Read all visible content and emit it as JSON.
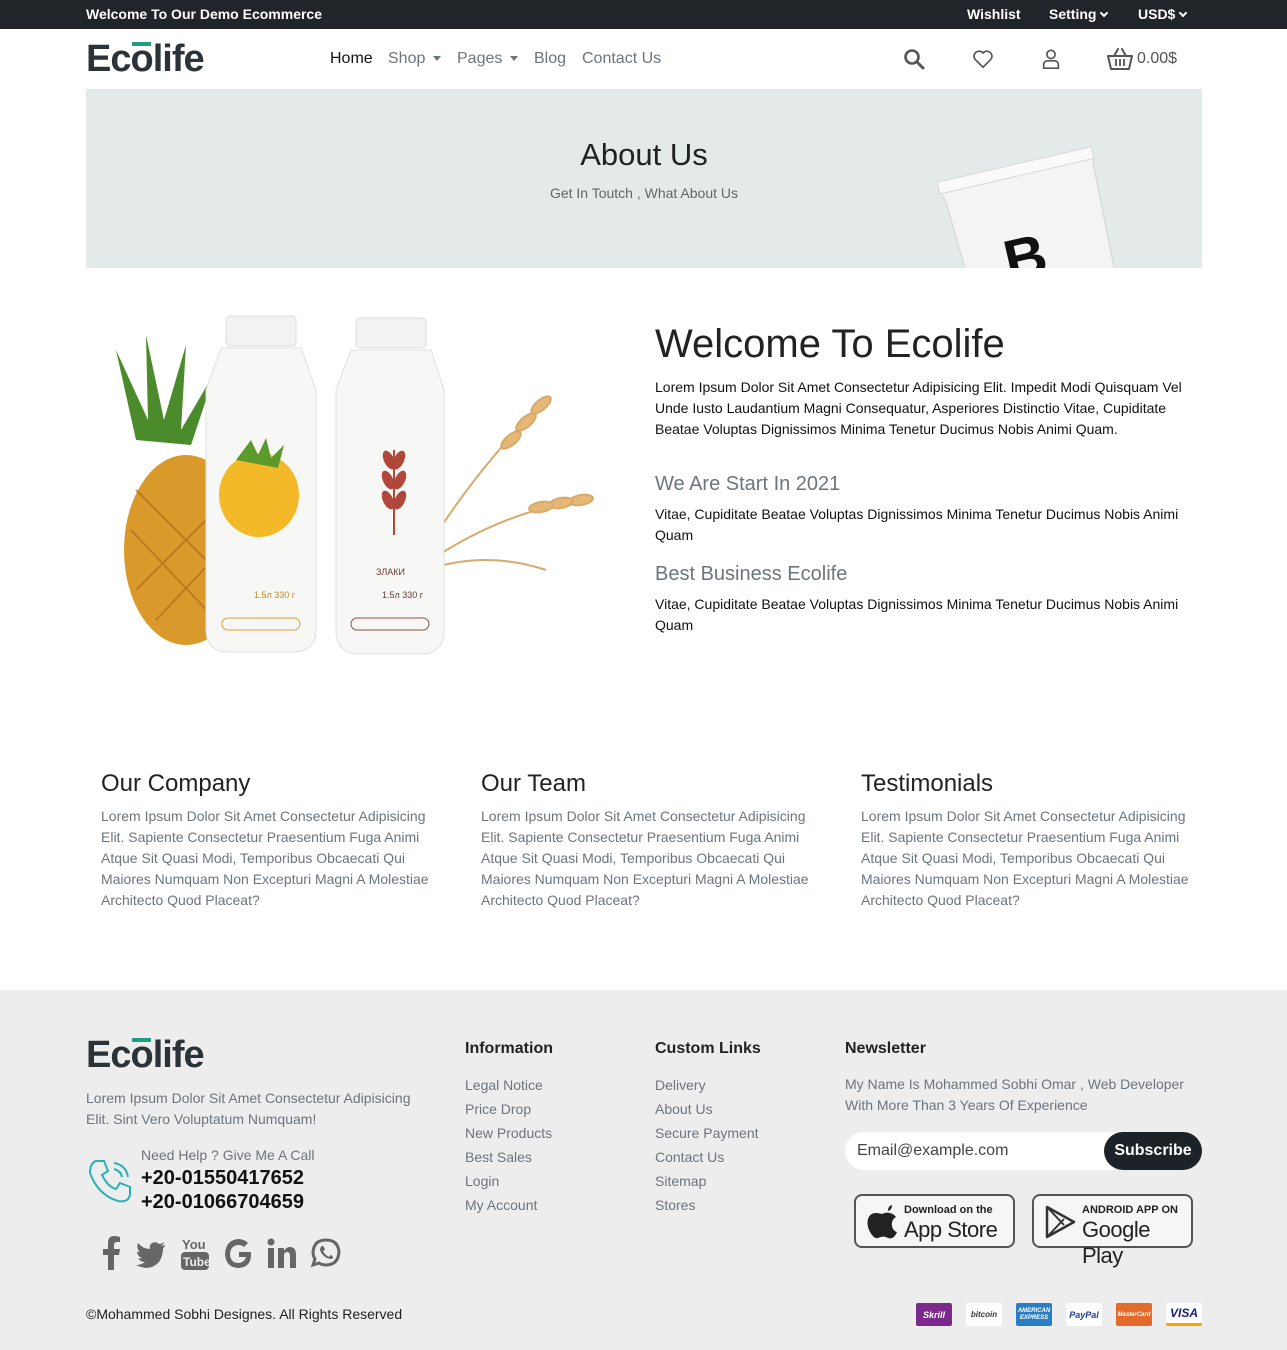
{
  "topbar": {
    "welcome": "Welcome To Our Demo Ecommerce",
    "wishlist": "Wishlist",
    "setting": "Setting",
    "currency": "USD$"
  },
  "brand": {
    "logo": "Ecolife"
  },
  "nav": {
    "home": "Home",
    "shop": "Shop",
    "pages": "Pages",
    "blog": "Blog",
    "contact": "Contact Us",
    "cart_total": "0.00$"
  },
  "hero": {
    "title": "About Us",
    "subtitle": "Get In Toutch , What About Us"
  },
  "about": {
    "title": "Welcome To Ecolife",
    "intro": "Lorem Ipsum Dolor Sit Amet Consectetur Adipisicing Elit. Impedit Modi Quisquam Vel Unde Iusto Laudantium Magni Consequatur, Asperiores Distinctio Vitae, Cupiditate Beatae Voluptas Dignissimos Minima Tenetur Ducimus Nobis Animi Quam.",
    "section1_title": "We Are Start In 2021",
    "section1_text": "Vitae, Cupiditate Beatae Voluptas Dignissimos Minima Tenetur Ducimus Nobis Animi Quam",
    "section2_title": "Best Business Ecolife",
    "section2_text": "Vitae, Cupiditate Beatae Voluptas Dignissimos Minima Tenetur Ducimus Nobis Animi Quam",
    "bottle1_label": "1.5л  330 г",
    "bottle2_label": "ЗЛАКИ",
    "bottle2_sub": "1.5л  330 г"
  },
  "features": [
    {
      "title": "Our Company",
      "text": "Lorem Ipsum Dolor Sit Amet Consectetur Adipisicing Elit. Sapiente Consectetur Praesentium Fuga Animi Atque Sit Quasi Modi, Temporibus Obcaecati Qui Maiores Numquam Non Excepturi Magni A Molestiae Architecto Quod Placeat?"
    },
    {
      "title": "Our Team",
      "text": "Lorem Ipsum Dolor Sit Amet Consectetur Adipisicing Elit. Sapiente Consectetur Praesentium Fuga Animi Atque Sit Quasi Modi, Temporibus Obcaecati Qui Maiores Numquam Non Excepturi Magni A Molestiae Architecto Quod Placeat?"
    },
    {
      "title": "Testimonials",
      "text": "Lorem Ipsum Dolor Sit Amet Consectetur Adipisicing Elit. Sapiente Consectetur Praesentium Fuga Animi Atque Sit Quasi Modi, Temporibus Obcaecati Qui Maiores Numquam Non Excepturi Magni A Molestiae Architecto Quod Placeat?"
    }
  ],
  "footer": {
    "description": "Lorem Ipsum Dolor Sit Amet Consectetur Adipisicing Elit. Sint Vero Voluptatum Numquam!",
    "help_label": "Need Help ? Give Me A Call",
    "phone1": "+20-01550417652",
    "phone2": "+20-01066704659",
    "information": {
      "title": "Information",
      "links": [
        "Legal Notice",
        "Price Drop",
        "New Products",
        "Best Sales",
        "Login",
        "My Account"
      ]
    },
    "custom_links": {
      "title": "Custom Links",
      "links": [
        "Delivery",
        "About Us",
        "Secure Payment",
        "Contact Us",
        "Sitemap",
        "Stores"
      ]
    },
    "newsletter": {
      "title": "Newsletter",
      "text": "My Name Is Mohammed Sobhi Omar , Web Developer With More Than 3 Years Of Experience",
      "placeholder": "Email@example.com",
      "button": "Subscribe"
    },
    "app_store": {
      "small": "Download on the",
      "big": "App Store"
    },
    "google_play": {
      "small": "ANDROID APP ON",
      "big": "Google Play"
    },
    "copyright": "©Mohammed Sobhi Designes. All Rights Reserved",
    "payments": [
      "Skrill",
      "bitcoin",
      "AMERICAN EXPRESS",
      "PayPal",
      "MasterCard",
      "VISA"
    ]
  },
  "colors": {
    "topbar_bg": "#212529",
    "brand_green": "#1e9e7e",
    "hero_bg": "#e4e9ea",
    "footer_bg": "#ededed",
    "button_dark": "#1d2226",
    "muted_text": "#6c757d"
  },
  "icons": {
    "search": "search-icon",
    "wishlist": "heart-icon",
    "account": "user-icon",
    "cart": "basket-icon",
    "phone": "phone-icon",
    "social": [
      "facebook-icon",
      "twitter-icon",
      "youtube-icon",
      "google-icon",
      "linkedin-icon",
      "whatsapp-icon"
    ]
  }
}
